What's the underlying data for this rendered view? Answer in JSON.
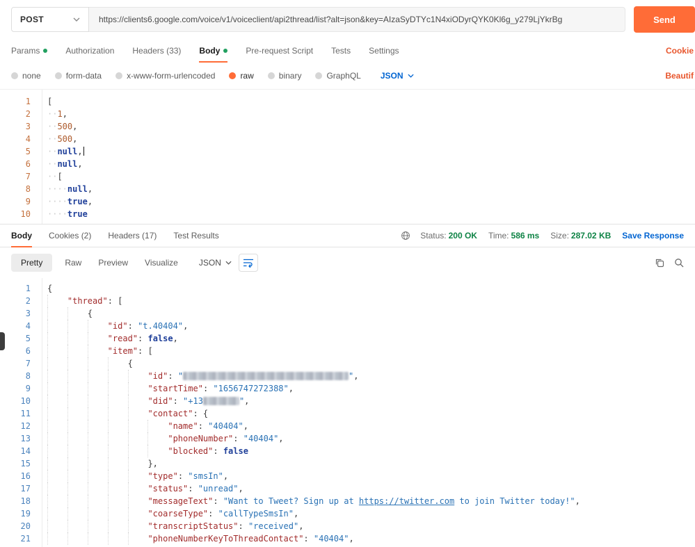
{
  "colors": {
    "accent": "#ff6c37",
    "link_blue": "#0265d2",
    "success_green": "#0e8345",
    "orange_link": "#e8562d"
  },
  "request": {
    "method": "POST",
    "url": "https://clients6.google.com/voice/v1/voiceclient/api2thread/list?alt=json&key=AIzaSyDTYc1N4xiODyrQYK0Kl6g_y279LjYkrBg",
    "send_label": "Send",
    "cookies_link": "Cookie",
    "beautify_link": "Beautif",
    "tabs": [
      {
        "label": "Params",
        "dot": true,
        "active": false
      },
      {
        "label": "Authorization",
        "dot": false,
        "active": false
      },
      {
        "label": "Headers (33)",
        "dot": false,
        "active": false
      },
      {
        "label": "Body",
        "dot": true,
        "active": true
      },
      {
        "label": "Pre-request Script",
        "dot": false,
        "active": false
      },
      {
        "label": "Tests",
        "dot": false,
        "active": false
      },
      {
        "label": "Settings",
        "dot": false,
        "active": false
      }
    ],
    "body_modes": [
      {
        "label": "none",
        "selected": false
      },
      {
        "label": "form-data",
        "selected": false
      },
      {
        "label": "x-www-form-urlencoded",
        "selected": false
      },
      {
        "label": "raw",
        "selected": true
      },
      {
        "label": "binary",
        "selected": false
      },
      {
        "label": "GraphQL",
        "selected": false
      }
    ],
    "language": "JSON",
    "editor_lines": [
      {
        "t": [
          [
            "p",
            "["
          ]
        ]
      },
      {
        "t": [
          [
            "ws",
            "··"
          ],
          [
            "n",
            "1"
          ],
          [
            "p",
            ","
          ]
        ]
      },
      {
        "t": [
          [
            "ws",
            "··"
          ],
          [
            "n",
            "500"
          ],
          [
            "p",
            ","
          ]
        ]
      },
      {
        "t": [
          [
            "ws",
            "··"
          ],
          [
            "n",
            "500"
          ],
          [
            "p",
            ","
          ]
        ]
      },
      {
        "t": [
          [
            "ws",
            "··"
          ],
          [
            "b",
            "null"
          ],
          [
            "p",
            ","
          ],
          [
            "cur",
            ""
          ]
        ]
      },
      {
        "t": [
          [
            "ws",
            "··"
          ],
          [
            "b",
            "null"
          ],
          [
            "p",
            ","
          ]
        ]
      },
      {
        "t": [
          [
            "ws",
            "··"
          ],
          [
            "p",
            "["
          ]
        ]
      },
      {
        "t": [
          [
            "ws",
            "····"
          ],
          [
            "b",
            "null"
          ],
          [
            "p",
            ","
          ]
        ]
      },
      {
        "t": [
          [
            "ws",
            "····"
          ],
          [
            "b",
            "true"
          ],
          [
            "p",
            ","
          ]
        ]
      },
      {
        "t": [
          [
            "ws",
            "····"
          ],
          [
            "b",
            "true"
          ]
        ]
      }
    ]
  },
  "response": {
    "tabs": [
      "Body",
      "Cookies (2)",
      "Headers (17)",
      "Test Results"
    ],
    "status": {
      "label": "Status:",
      "value": "200 OK"
    },
    "time": {
      "label": "Time:",
      "value": "586 ms"
    },
    "size": {
      "label": "Size:",
      "value": "287.02 KB"
    },
    "save_label": "Save Response",
    "view_tabs": [
      "Pretty",
      "Raw",
      "Preview",
      "Visualize"
    ],
    "format": "JSON",
    "body_lines": [
      {
        "g": 0,
        "t": [
          [
            "p",
            "{"
          ]
        ]
      },
      {
        "g": 1,
        "t": [
          [
            "k",
            "\"thread\""
          ],
          [
            "p",
            ": ["
          ]
        ]
      },
      {
        "g": 2,
        "t": [
          [
            "p",
            "{"
          ]
        ]
      },
      {
        "g": 3,
        "t": [
          [
            "k",
            "\"id\""
          ],
          [
            "p",
            ": "
          ],
          [
            "s",
            "\"t.40404\""
          ],
          [
            "p",
            ","
          ]
        ]
      },
      {
        "g": 3,
        "t": [
          [
            "k",
            "\"read\""
          ],
          [
            "p",
            ": "
          ],
          [
            "b",
            "false"
          ],
          [
            "p",
            ","
          ]
        ]
      },
      {
        "g": 3,
        "t": [
          [
            "k",
            "\"item\""
          ],
          [
            "p",
            ": ["
          ]
        ]
      },
      {
        "g": 4,
        "t": [
          [
            "p",
            "{"
          ]
        ]
      },
      {
        "g": 5,
        "t": [
          [
            "k",
            "\"id\""
          ],
          [
            "p",
            ": "
          ],
          [
            "s",
            "\""
          ],
          [
            "r",
            "238"
          ],
          [
            "s",
            "\""
          ],
          [
            "p",
            ","
          ]
        ]
      },
      {
        "g": 5,
        "t": [
          [
            "k",
            "\"startTime\""
          ],
          [
            "p",
            ": "
          ],
          [
            "s",
            "\"1656747272388\""
          ],
          [
            "p",
            ","
          ]
        ]
      },
      {
        "g": 5,
        "t": [
          [
            "k",
            "\"did\""
          ],
          [
            "p",
            ": "
          ],
          [
            "s",
            "\"+13"
          ],
          [
            "r",
            "52"
          ],
          [
            "s",
            "\""
          ],
          [
            "p",
            ","
          ]
        ]
      },
      {
        "g": 5,
        "t": [
          [
            "k",
            "\"contact\""
          ],
          [
            "p",
            ": {"
          ]
        ]
      },
      {
        "g": 6,
        "t": [
          [
            "k",
            "\"name\""
          ],
          [
            "p",
            ": "
          ],
          [
            "s",
            "\"40404\""
          ],
          [
            "p",
            ","
          ]
        ]
      },
      {
        "g": 6,
        "t": [
          [
            "k",
            "\"phoneNumber\""
          ],
          [
            "p",
            ": "
          ],
          [
            "s",
            "\"40404\""
          ],
          [
            "p",
            ","
          ]
        ]
      },
      {
        "g": 6,
        "t": [
          [
            "k",
            "\"blocked\""
          ],
          [
            "p",
            ": "
          ],
          [
            "b",
            "false"
          ]
        ]
      },
      {
        "g": 5,
        "t": [
          [
            "p",
            "},"
          ]
        ]
      },
      {
        "g": 5,
        "t": [
          [
            "k",
            "\"type\""
          ],
          [
            "p",
            ": "
          ],
          [
            "s",
            "\"smsIn\""
          ],
          [
            "p",
            ","
          ]
        ]
      },
      {
        "g": 5,
        "t": [
          [
            "k",
            "\"status\""
          ],
          [
            "p",
            ": "
          ],
          [
            "s",
            "\"unread\""
          ],
          [
            "p",
            ","
          ]
        ]
      },
      {
        "g": 5,
        "t": [
          [
            "k",
            "\"messageText\""
          ],
          [
            "p",
            ": "
          ],
          [
            "s",
            "\"Want to Tweet? Sign up at "
          ],
          [
            "lk",
            "https://twitter.com"
          ],
          [
            "s",
            " to join Twitter today!\""
          ],
          [
            "p",
            ","
          ]
        ]
      },
      {
        "g": 5,
        "t": [
          [
            "k",
            "\"coarseType\""
          ],
          [
            "p",
            ": "
          ],
          [
            "s",
            "\"callTypeSmsIn\""
          ],
          [
            "p",
            ","
          ]
        ]
      },
      {
        "g": 5,
        "t": [
          [
            "k",
            "\"transcriptStatus\""
          ],
          [
            "p",
            ": "
          ],
          [
            "s",
            "\"received\""
          ],
          [
            "p",
            ","
          ]
        ]
      },
      {
        "g": 5,
        "t": [
          [
            "k",
            "\"phoneNumberKeyToThreadContact\""
          ],
          [
            "p",
            ": "
          ],
          [
            "s",
            "\"40404\""
          ],
          [
            "p",
            ","
          ]
        ]
      }
    ]
  }
}
